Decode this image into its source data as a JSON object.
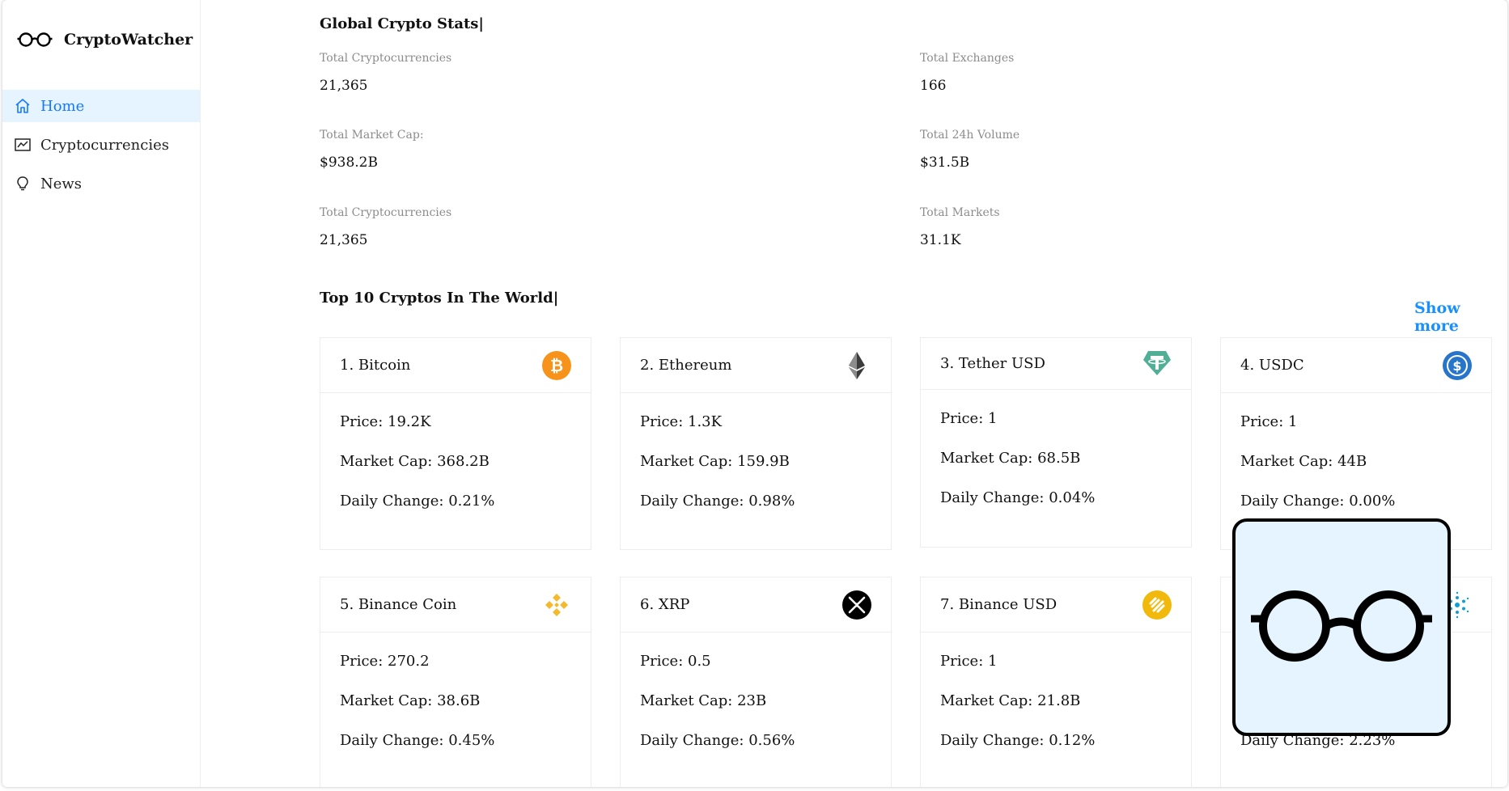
{
  "app": {
    "name": "CryptoWatcher"
  },
  "sidebar": {
    "items": [
      {
        "label": "Home",
        "icon": "home-icon",
        "active": true
      },
      {
        "label": "Cryptocurrencies",
        "icon": "chart-icon",
        "active": false
      },
      {
        "label": "News",
        "icon": "bulb-icon",
        "active": false
      }
    ]
  },
  "global_stats": {
    "title": "Global Crypto Stats|",
    "items": [
      {
        "label": "Total Cryptocurrencies",
        "value": "21,365"
      },
      {
        "label": "Total Exchanges",
        "value": "166"
      },
      {
        "label": "Total Market Cap:",
        "value": "$938.2B"
      },
      {
        "label": "Total 24h Volume",
        "value": "$31.5B"
      },
      {
        "label": "Total Cryptocurrencies",
        "value": "21,365"
      },
      {
        "label": "Total Markets",
        "value": "31.1K"
      }
    ]
  },
  "top_cryptos": {
    "title": "Top 10 Cryptos In The World|",
    "show_more": "Show more",
    "cards": [
      {
        "name": "1. Bitcoin",
        "price": "Price: 19.2K",
        "market_cap": "Market Cap: 368.2B",
        "daily_change": "Daily Change: 0.21%",
        "icon": "bitcoin-icon",
        "color": "#f7931a"
      },
      {
        "name": "2. Ethereum",
        "price": "Price: 1.3K",
        "market_cap": "Market Cap: 159.9B",
        "daily_change": "Daily Change: 0.98%",
        "icon": "ethereum-icon",
        "color": "#3c3c3d"
      },
      {
        "name": "3. Tether USD",
        "price": "Price: 1",
        "market_cap": "Market Cap: 68.5B",
        "daily_change": "Daily Change: 0.04%",
        "icon": "tether-icon",
        "color": "#50af95"
      },
      {
        "name": "4. USDC",
        "price": "Price: 1",
        "market_cap": "Market Cap: 44B",
        "daily_change": "Daily Change: 0.00%",
        "icon": "usdc-icon",
        "color": "#2775ca"
      },
      {
        "name": "5. Binance Coin",
        "price": "Price: 270.2",
        "market_cap": "Market Cap: 38.6B",
        "daily_change": "Daily Change: 0.45%",
        "icon": "binance-icon",
        "color": "#f3ba2f"
      },
      {
        "name": "6. XRP",
        "price": "Price: 0.5",
        "market_cap": "Market Cap: 23B",
        "daily_change": "Daily Change: 0.56%",
        "icon": "xrp-icon",
        "color": "#000000"
      },
      {
        "name": "7. Binance USD",
        "price": "Price: 1",
        "market_cap": "Market Cap: 21.8B",
        "daily_change": "Daily Change: 0.12%",
        "icon": "binance-usd-icon",
        "color": "#f0b90b"
      },
      {
        "name": "",
        "price": "",
        "market_cap": "",
        "daily_change": "Daily Change: 2.23%",
        "icon": "cardano-icon",
        "color": "#0d9fd8"
      }
    ]
  },
  "colors": {
    "accent": "#1890ff",
    "active_bg": "#e6f4ff"
  }
}
